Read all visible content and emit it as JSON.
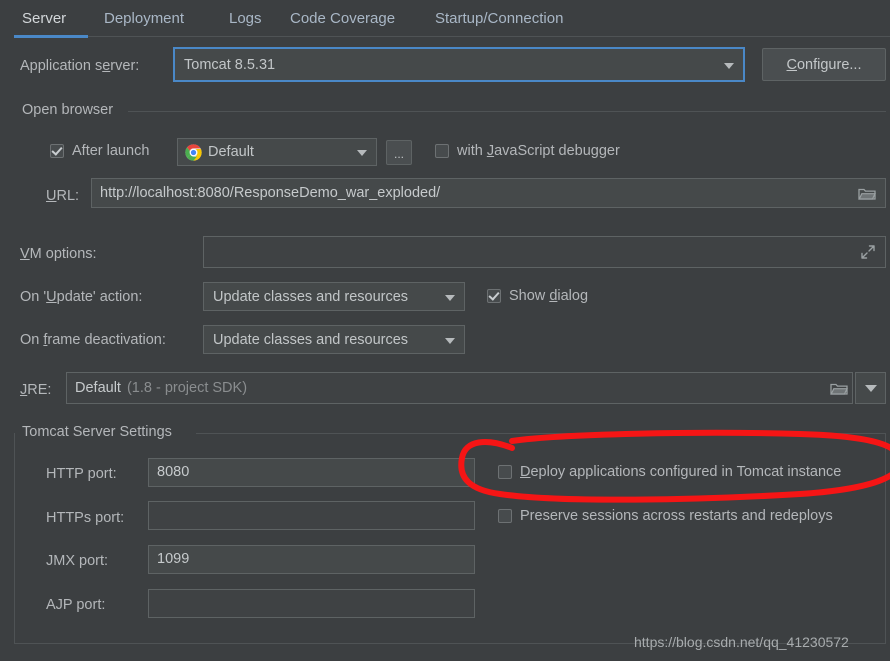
{
  "window": {
    "background": "#3c3f41",
    "accent": "#4a88c7"
  },
  "tabs": [
    {
      "label": "Server",
      "active": true
    },
    {
      "label": "Deployment",
      "active": false
    },
    {
      "label": "Logs",
      "active": false
    },
    {
      "label": "Code Coverage",
      "active": false
    },
    {
      "label": "Startup/Connection",
      "active": false
    }
  ],
  "application_server": {
    "label_pre": "Application s",
    "label_mn": "e",
    "label_post": "rver:",
    "value": "Tomcat 8.5.31",
    "configure_mn": "C",
    "configure_post": "onfigure...",
    "caret_icon": "chevron-down-icon"
  },
  "open_browser": {
    "group_title": "Open browser",
    "after_launch": {
      "label": "After launch",
      "checked": true
    },
    "browser": {
      "value": "Default",
      "icon": "chrome-icon"
    },
    "more_button": "...",
    "js_debugger": {
      "label_pre": "with ",
      "label_mn": "J",
      "label_post": "avaScript debugger",
      "checked": false
    },
    "url": {
      "label_mn": "U",
      "label_post": "RL:",
      "value": "http://localhost:8080/ResponseDemo_war_exploded/",
      "browse_icon": "folder-icon"
    }
  },
  "vm_options": {
    "label_mn": "V",
    "label_post": "M options:",
    "value": "",
    "expand_icon": "expand-icon"
  },
  "on_update_action": {
    "label_pre": "On '",
    "label_mn": "U",
    "label_post": "pdate' action:",
    "value": "Update classes and resources",
    "show_dialog": {
      "label_pre": "Show ",
      "label_mn": "d",
      "label_post": "ialog",
      "checked": true
    }
  },
  "on_frame_deactivation": {
    "label_pre": "On ",
    "label_mn": "f",
    "label_post": "rame deactivation:",
    "value": "Update classes and resources"
  },
  "jre": {
    "label_mn": "J",
    "label_post": "RE:",
    "value": "Default",
    "value_hint": "(1.8 - project SDK)",
    "browse_icon": "folder-icon",
    "caret_icon": "chevron-down-icon"
  },
  "tomcat_server_settings": {
    "group_title": "Tomcat Server Settings",
    "ports": [
      {
        "label": "HTTP port:",
        "value": "8080"
      },
      {
        "label": "HTTPs port:",
        "value": ""
      },
      {
        "label": "JMX port:",
        "value": "1099"
      },
      {
        "label": "AJP port:",
        "value": ""
      }
    ],
    "deploy_apps": {
      "label_mn": "D",
      "label_post": "eploy applications configured in Tomcat instance",
      "checked": false
    },
    "preserve_sessions": {
      "label": "Preserve sessions across restarts and redeploys",
      "checked": false
    }
  },
  "annotation": {
    "shape": "red-ellipse-highlight",
    "color": "#f51515",
    "target": "Deploy applications configured in Tomcat instance"
  },
  "watermark": {
    "text": "https://blog.csdn.net/qq_41230572"
  }
}
